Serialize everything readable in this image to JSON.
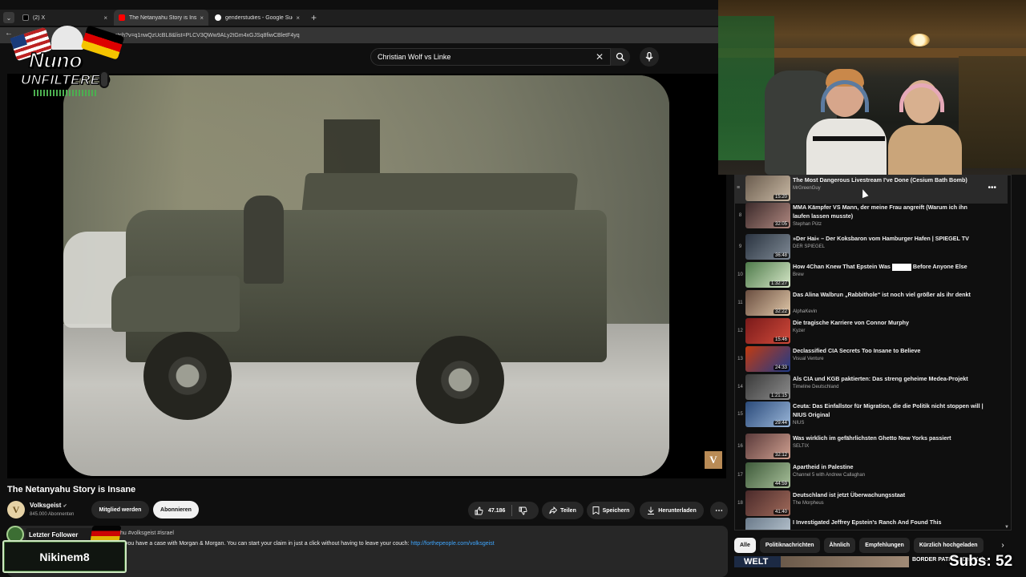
{
  "browser": {
    "tabs": [
      {
        "label": "(2) X",
        "favicon_color": "#000000"
      },
      {
        "label": "The Netanyahu Story is Insane",
        "favicon_color": "#ff0000"
      },
      {
        "label": "genderstudies - Google Suche",
        "favicon_color": "#4285f4"
      }
    ],
    "new_tab": "+",
    "close": "×",
    "url": "m/watch?v=q1nwQzUcBL8&list=PLCV3QWw9ALy2tGm4xGJSq8fiwCBletF4yq"
  },
  "overlay_logo": {
    "line1": "Nuno",
    "line2": "UNFILTERED"
  },
  "search": {
    "query": "Christian Wolf vs Linke",
    "clear": "✕"
  },
  "video": {
    "title": "The Netanyahu Story is Insane",
    "watermark": "V"
  },
  "channel": {
    "avatar_letter": "V",
    "name": "Volksgeist",
    "verified": "✔",
    "subscribers": "845.000 Abonnenten"
  },
  "actions": {
    "member": "Mitglied werden",
    "subscribe": "Abonnieren",
    "likes": "47.186",
    "share": "Teilen",
    "save": "Speichern",
    "download": "Herunterladen",
    "more": "⋯"
  },
  "description": {
    "tags": "hu #volksgeist #israel",
    "text": "you have a case with Morgan & Morgan. You can start your claim in just a click without having to leave your couch: ",
    "link": "http://forthepeople.com/volksgeist"
  },
  "follower_overlay": {
    "label": "Letzter Follower",
    "name": "Nikinem8"
  },
  "playlist": [
    {
      "index": "",
      "title": "The Most Dangerous Livestream I've Done (Cesium Bath Bomb)",
      "channel": "MrGreenGuy",
      "duration": "15:20",
      "active": true,
      "thumb": [
        "#6a5c4e",
        "#c9b9a4"
      ]
    },
    {
      "index": "8",
      "title": "MMA Kämpfer VS Mann, der meine Frau angreift (Warum ich ihn laufen lassen musste)",
      "channel": "Stephan Pütz",
      "duration": "32:05",
      "thumb": [
        "#3b2a2a",
        "#b08880"
      ]
    },
    {
      "index": "9",
      "title": "»Der Hai« – Der Koksbaron vom Hamburger Hafen | SPIEGEL TV",
      "channel": "DER SPIEGEL",
      "duration": "36:48",
      "thumb": [
        "#2a3340",
        "#7f8a95"
      ]
    },
    {
      "index": "10",
      "title_pre": "How 4Chan Knew That Epstein Was ",
      "title_post": " Before Anyone Else",
      "channel": "Brew",
      "duration": "1:32:27",
      "thumb": [
        "#4e7a4a",
        "#d7e8c9"
      ]
    },
    {
      "index": "11",
      "title": "Das Alina Walbrun „Rabbithole“ ist noch viel größer als ihr denkt",
      "channel": "AlphaKevin",
      "duration": "32:22",
      "thumb": [
        "#6a4e40",
        "#e0c7a8"
      ]
    },
    {
      "index": "12",
      "title": "Die tragische Karriere von Connor Murphy",
      "channel": "Kyzer",
      "duration": "15:46",
      "thumb": [
        "#7a1a1a",
        "#d04a3a"
      ]
    },
    {
      "index": "13",
      "title": "Declassified CIA Secrets Too Insane to Believe",
      "channel": "Visual Venture",
      "duration": "24:33",
      "thumb": [
        "#c23a10",
        "#1e3b8a"
      ]
    },
    {
      "index": "14",
      "title": "Als CIA und KGB paktierten: Das streng geheime Medea-Projekt",
      "channel": "Timeline Deutschland",
      "duration": "1:21:15",
      "thumb": [
        "#3a3a3a",
        "#8d8d8d"
      ]
    },
    {
      "index": "15",
      "title": "Ceuta: Das Einfallstor für Migration, die die Politik nicht stoppen will | NIUS Original",
      "channel": "NIUS",
      "duration": "29:44",
      "thumb": [
        "#2a4a7a",
        "#9ab6d8"
      ]
    },
    {
      "index": "16",
      "title": "Was wirklich im gefährlichsten Ghetto New Yorks passiert",
      "channel": "SELTIX",
      "duration": "32:12",
      "thumb": [
        "#5a3a3a",
        "#d0a090"
      ]
    },
    {
      "index": "17",
      "title": "Apartheid in Palestine",
      "channel": "Channel 5 with Andrew Callaghan",
      "duration": "44:59",
      "thumb": [
        "#3e5a3a",
        "#a8c09a"
      ]
    },
    {
      "index": "18",
      "title": "Deutschland ist jetzt Überwachungsstaat",
      "channel": "The Morpheus",
      "duration": "41:40",
      "thumb": [
        "#4a2a2a",
        "#a06a5a"
      ]
    },
    {
      "index": "",
      "title": "I Investigated Jeffrey Epstein's Ranch And Found This",
      "channel": "",
      "duration": "",
      "thumb": [
        "#6a7a8a",
        "#c0ccd6"
      ]
    }
  ],
  "chips": [
    "Alle",
    "Politiknachrichten",
    "Ähnlich",
    "Empfehlungen",
    "Kürzlich hochgeladen"
  ],
  "chip_next": "›",
  "bottom": {
    "welt": "WELT",
    "ticker": "BORDER PATHS... Das Kai...",
    "subs": "Subs: 52"
  },
  "colors": {
    "accent_red": "#ff0000",
    "link_blue": "#3ea6ff",
    "follower_green": "#3b6d31"
  }
}
